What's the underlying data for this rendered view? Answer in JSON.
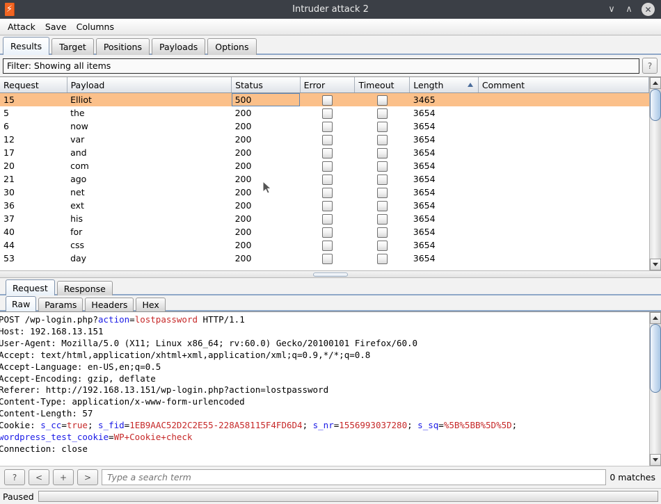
{
  "window": {
    "title": "Intruder attack 2",
    "icon": "burp-bolt-icon",
    "minimize": "∨",
    "maximize": "∧",
    "close": "✕"
  },
  "menubar": {
    "items": [
      "Attack",
      "Save",
      "Columns"
    ]
  },
  "main_tabs": {
    "items": [
      "Results",
      "Target",
      "Positions",
      "Payloads",
      "Options"
    ],
    "active": "Results"
  },
  "filter": {
    "text": "Filter: Showing all items",
    "help_label": "?"
  },
  "results_table": {
    "columns": [
      "Request",
      "Payload",
      "Status",
      "Error",
      "Timeout",
      "Length",
      "Comment"
    ],
    "sorted_column": "Length",
    "sort_direction": "ascending",
    "rows": [
      {
        "request": "15",
        "payload": "Elliot",
        "status": "500",
        "error": false,
        "timeout": false,
        "length": "3465",
        "comment": "",
        "selected": true
      },
      {
        "request": "5",
        "payload": "the",
        "status": "200",
        "error": false,
        "timeout": false,
        "length": "3654",
        "comment": "",
        "selected": false
      },
      {
        "request": "6",
        "payload": "now",
        "status": "200",
        "error": false,
        "timeout": false,
        "length": "3654",
        "comment": "",
        "selected": false
      },
      {
        "request": "12",
        "payload": "var",
        "status": "200",
        "error": false,
        "timeout": false,
        "length": "3654",
        "comment": "",
        "selected": false
      },
      {
        "request": "17",
        "payload": "and",
        "status": "200",
        "error": false,
        "timeout": false,
        "length": "3654",
        "comment": "",
        "selected": false
      },
      {
        "request": "20",
        "payload": "com",
        "status": "200",
        "error": false,
        "timeout": false,
        "length": "3654",
        "comment": "",
        "selected": false
      },
      {
        "request": "21",
        "payload": "ago",
        "status": "200",
        "error": false,
        "timeout": false,
        "length": "3654",
        "comment": "",
        "selected": false
      },
      {
        "request": "30",
        "payload": "net",
        "status": "200",
        "error": false,
        "timeout": false,
        "length": "3654",
        "comment": "",
        "selected": false
      },
      {
        "request": "36",
        "payload": "ext",
        "status": "200",
        "error": false,
        "timeout": false,
        "length": "3654",
        "comment": "",
        "selected": false
      },
      {
        "request": "37",
        "payload": "his",
        "status": "200",
        "error": false,
        "timeout": false,
        "length": "3654",
        "comment": "",
        "selected": false
      },
      {
        "request": "40",
        "payload": "for",
        "status": "200",
        "error": false,
        "timeout": false,
        "length": "3654",
        "comment": "",
        "selected": false
      },
      {
        "request": "44",
        "payload": "css",
        "status": "200",
        "error": false,
        "timeout": false,
        "length": "3654",
        "comment": "",
        "selected": false
      },
      {
        "request": "53",
        "payload": "day",
        "status": "200",
        "error": false,
        "timeout": false,
        "length": "3654",
        "comment": "",
        "selected": false
      }
    ]
  },
  "message_tabs": {
    "items": [
      "Request",
      "Response"
    ],
    "active": "Request"
  },
  "format_tabs": {
    "items": [
      "Raw",
      "Params",
      "Headers",
      "Hex"
    ],
    "active": "Raw"
  },
  "request_body": {
    "lines": [
      [
        {
          "t": "POST /wp-login.php?",
          "c": ""
        },
        {
          "t": "action",
          "c": "b"
        },
        {
          "t": "=",
          "c": ""
        },
        {
          "t": "lostpassword",
          "c": "r"
        },
        {
          "t": " HTTP/1.1",
          "c": ""
        }
      ],
      [
        {
          "t": "Host: 192.168.13.151",
          "c": ""
        }
      ],
      [
        {
          "t": "User-Agent: Mozilla/5.0 (X11; Linux x86_64; rv:60.0) Gecko/20100101 Firefox/60.0",
          "c": ""
        }
      ],
      [
        {
          "t": "Accept: text/html,application/xhtml+xml,application/xml;q=0.9,*/*;q=0.8",
          "c": ""
        }
      ],
      [
        {
          "t": "Accept-Language: en-US,en;q=0.5",
          "c": ""
        }
      ],
      [
        {
          "t": "Accept-Encoding: gzip, deflate",
          "c": ""
        }
      ],
      [
        {
          "t": "Referer: http://192.168.13.151/wp-login.php?action=lostpassword",
          "c": ""
        }
      ],
      [
        {
          "t": "Content-Type: application/x-www-form-urlencoded",
          "c": ""
        }
      ],
      [
        {
          "t": "Content-Length: 57",
          "c": ""
        }
      ],
      [
        {
          "t": "Cookie: ",
          "c": ""
        },
        {
          "t": "s_cc",
          "c": "b"
        },
        {
          "t": "=",
          "c": ""
        },
        {
          "t": "true",
          "c": "r"
        },
        {
          "t": "; ",
          "c": ""
        },
        {
          "t": "s_fid",
          "c": "b"
        },
        {
          "t": "=",
          "c": ""
        },
        {
          "t": "1EB9AAC52D2C2E55-228A58115F4FD6D4",
          "c": "r"
        },
        {
          "t": "; ",
          "c": ""
        },
        {
          "t": "s_nr",
          "c": "b"
        },
        {
          "t": "=",
          "c": ""
        },
        {
          "t": "1556993037280",
          "c": "r"
        },
        {
          "t": "; ",
          "c": ""
        },
        {
          "t": "s_sq",
          "c": "b"
        },
        {
          "t": "=",
          "c": ""
        },
        {
          "t": "%5B%5BB%5D%5D",
          "c": "r"
        },
        {
          "t": ";",
          "c": ""
        }
      ],
      [
        {
          "t": "wordpress_test_cookie",
          "c": "b"
        },
        {
          "t": "=",
          "c": ""
        },
        {
          "t": "WP+Cookie+check",
          "c": "r"
        }
      ],
      [
        {
          "t": "Connection: close",
          "c": ""
        }
      ]
    ]
  },
  "search": {
    "help_label": "?",
    "prev_label": "<",
    "plus_label": "+",
    "next_label": ">",
    "placeholder": "Type a search term",
    "value": "",
    "matches": "0 matches"
  },
  "statusbar": {
    "state": "Paused",
    "progress_percent": 0
  },
  "colors": {
    "selection": "#fbc08a",
    "accent": "#8fa8c8",
    "title_bg": "#3b3f46",
    "brand_orange": "#f26522",
    "token_name": "#1a1ae6",
    "token_value": "#c62828"
  }
}
